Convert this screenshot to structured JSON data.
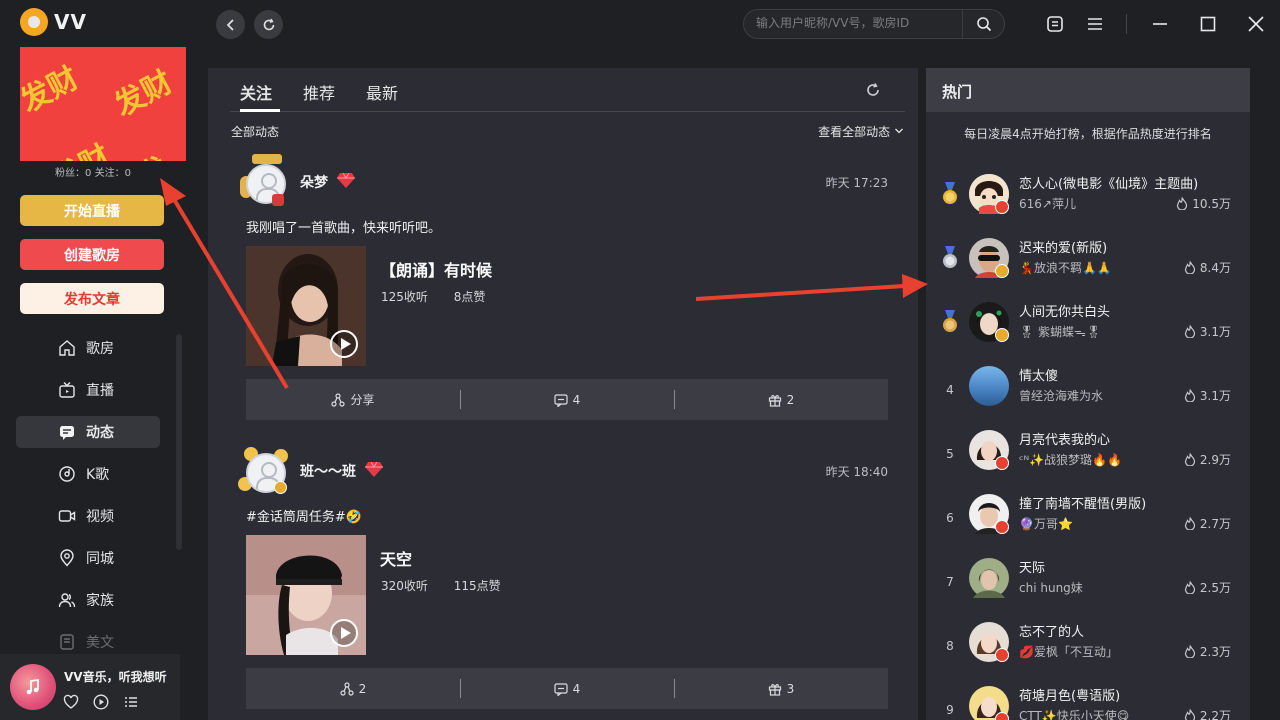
{
  "app": {
    "name": "VV"
  },
  "search": {
    "placeholder": "输入用户昵称/VV号，歌房ID"
  },
  "sidebar": {
    "banner_char": "发财",
    "stats": "粉丝：0 关注：0",
    "buttons": {
      "live": "开始直播",
      "room": "创建歌房",
      "post": "发布文章"
    },
    "menu": [
      {
        "label": "歌房",
        "icon": "home-icon"
      },
      {
        "label": "直播",
        "icon": "tv-icon"
      },
      {
        "label": "动态",
        "icon": "chat-icon",
        "active": true
      },
      {
        "label": "K歌",
        "icon": "vinyl-icon"
      },
      {
        "label": "视频",
        "icon": "video-icon"
      },
      {
        "label": "同城",
        "icon": "location-icon"
      },
      {
        "label": "家族",
        "icon": "group-icon"
      },
      {
        "label": "美文",
        "icon": "document-icon"
      }
    ]
  },
  "player": {
    "title": "VV音乐，听我想听"
  },
  "feed": {
    "tabs": [
      "关注",
      "推荐",
      "最新"
    ],
    "filter": "全部动态",
    "view_all": "查看全部动态",
    "posts": [
      {
        "user": "朵梦",
        "time": "昨天 17:23",
        "text": "我刚唱了一首歌曲，快来听听吧。",
        "song": "【朗诵】有时候",
        "listens": "125收听",
        "likes": "8点赞",
        "share": "分享",
        "comments": "4",
        "gifts": "2"
      },
      {
        "user": "班～～班",
        "time": "昨天 18:40",
        "text": "#金话筒周任务#🤣",
        "song": "天空",
        "listens": "320收听",
        "likes": "115点赞",
        "share": "2",
        "comments": "4",
        "gifts": "3"
      }
    ]
  },
  "hot": {
    "title": "热门",
    "subtitle": "每日凌晨4点开始打榜，根据作品热度进行排名",
    "items": [
      {
        "rank": "1",
        "song": "恋人心(微电影《仙境》主题曲)",
        "singer": "616↗萍儿",
        "heat": "10.5万"
      },
      {
        "rank": "2",
        "song": "迟来的爱(新版)",
        "singer": "💃放浪不羁🙏🙏",
        "heat": "8.4万"
      },
      {
        "rank": "3",
        "song": "人间无你共白头",
        "singer": "🎖 紫蝴蝶ᯓ🎖",
        "heat": "3.1万"
      },
      {
        "rank": "4",
        "song": "情太傻",
        "singer": "曾经沧海难为水",
        "heat": "3.1万"
      },
      {
        "rank": "5",
        "song": "月亮代表我的心",
        "singer": "ᶜᴺ✨战狼梦璐🔥🔥",
        "heat": "2.9万"
      },
      {
        "rank": "6",
        "song": "撞了南墙不醒悟(男版)",
        "singer": "🔮万哥⭐",
        "heat": "2.7万"
      },
      {
        "rank": "7",
        "song": "天际",
        "singer": "chi hung妹",
        "heat": "2.5万"
      },
      {
        "rank": "8",
        "song": "忘不了的人",
        "singer": "💋爱枫「不互动」",
        "heat": "2.3万"
      },
      {
        "rank": "9",
        "song": "荷塘月色(粤语版)",
        "singer": "CTT✨快乐小天使😋",
        "heat": "2.2万"
      }
    ]
  },
  "colors": {
    "accent_red": "#ef4a4d",
    "gold": "#e6b745",
    "panel": "#2c2d34",
    "bg": "#1f2023"
  }
}
